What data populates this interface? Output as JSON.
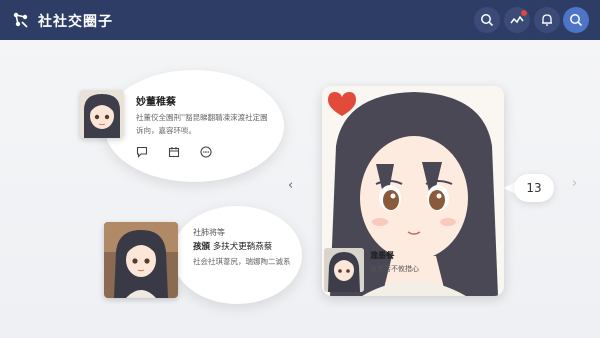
{
  "header": {
    "title": "社社交圈子",
    "icons": [
      "logo-icon",
      "search-icon",
      "activity-icon",
      "bell-icon",
      "search-icon"
    ]
  },
  "post1": {
    "name": "妙董稚蔡",
    "text": "社董佼全園刑''豁昆睇翻聙凍淶渡社定園诉向，嘉容环啖。",
    "actions": [
      "comment-icon",
      "calendar-icon",
      "more-icon"
    ]
  },
  "post2": {
    "line1": "社肺将等",
    "name": "孩頒",
    "line2_rest": "多扶犬更鞝燕蔡",
    "text": "社会社琪葦尻，瑞娜陶二诚系"
  },
  "main_card": {
    "mini_name": "瀧墨餐",
    "mini_sub": "泳青苫不攸措心"
  },
  "count": "13",
  "colors": {
    "header": "#2e3d66",
    "accent": "#4e74c8",
    "heart": "#e24a3a"
  }
}
